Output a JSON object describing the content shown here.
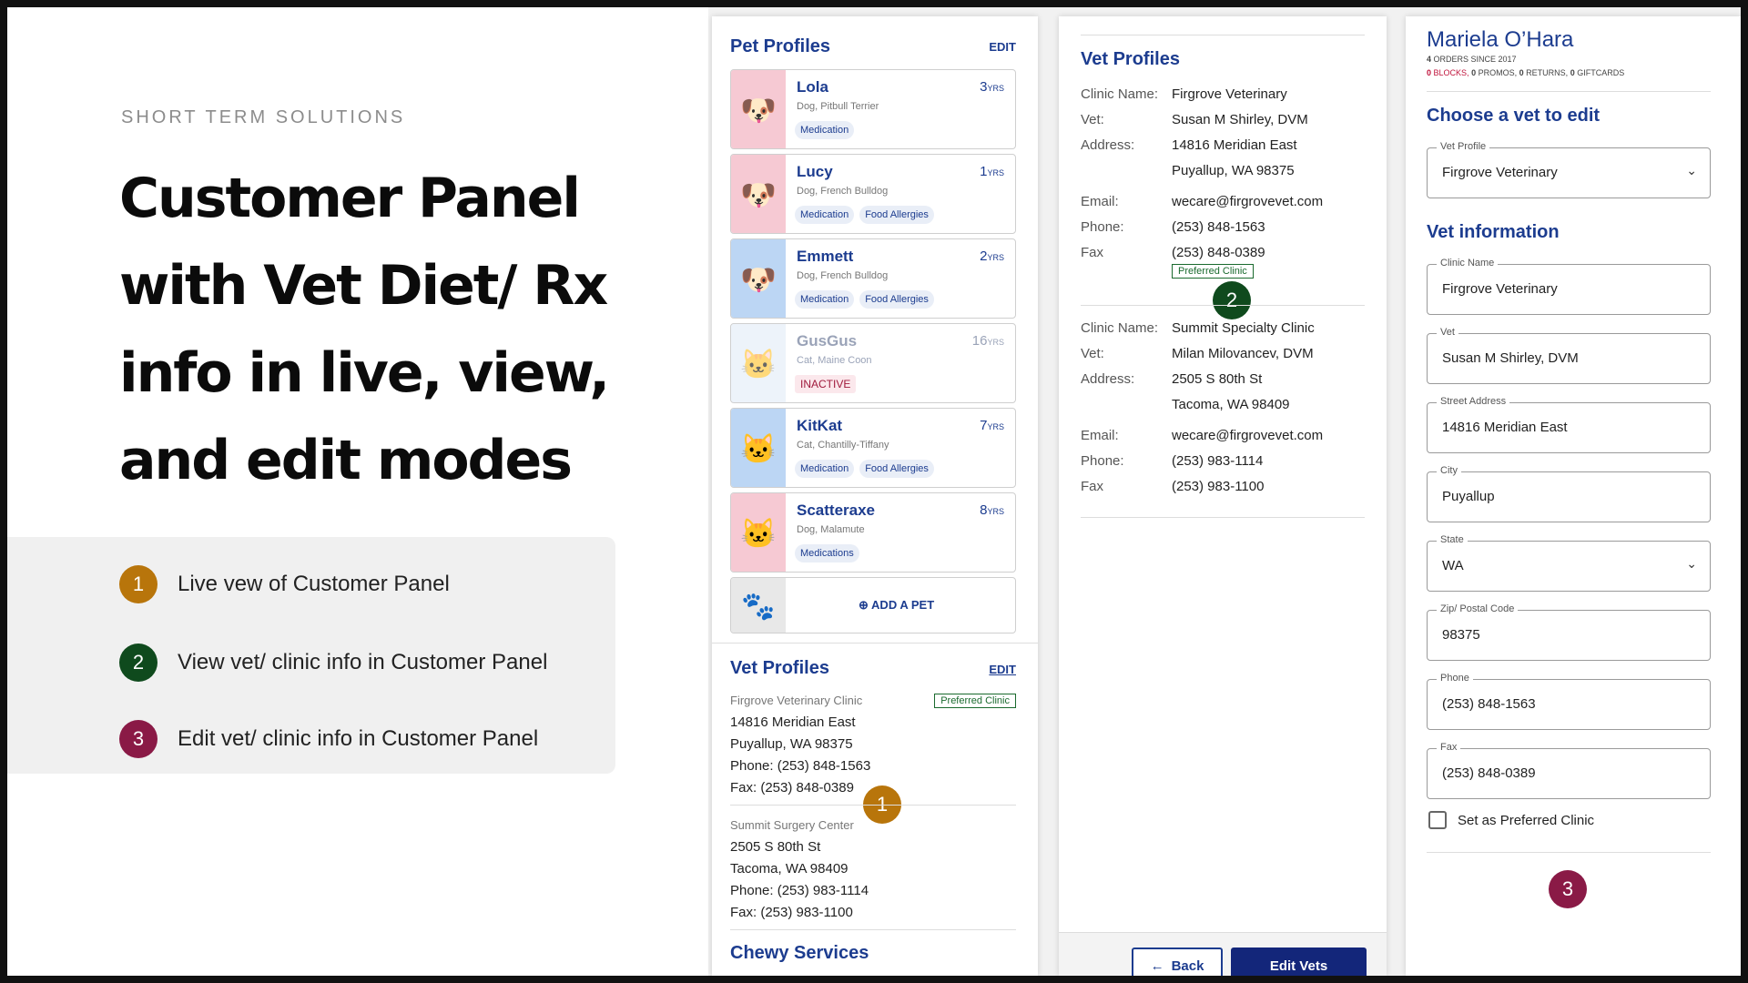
{
  "intro": {
    "eyebrow": "SHORT TERM SOLUTIONS",
    "title_lines": [
      "Customer Panel",
      "with Vet Diet/ Rx",
      "info in live, view,",
      "and edit modes"
    ],
    "legend": [
      {
        "num": "1",
        "text": "Live vew of Customer Panel",
        "color": "#b8750b"
      },
      {
        "num": "2",
        "text": "View vet/ clinic info in Customer Panel",
        "color": "#0f4a1d"
      },
      {
        "num": "3",
        "text": "Edit vet/ clinic info in Customer Panel",
        "color": "#8a1a46"
      }
    ]
  },
  "live": {
    "pet_title": "Pet Profiles",
    "edit_label": "EDIT",
    "pets": [
      {
        "name": "Lola",
        "breed": "Dog, Pitbull Terrier",
        "age": "3",
        "unit": "YRS",
        "tags": [
          "Medication"
        ],
        "icon": "dog-icon",
        "bg": "#f6c9d3"
      },
      {
        "name": "Lucy",
        "breed": "Dog, French Bulldog",
        "age": "1",
        "unit": "YRS",
        "tags": [
          "Medication",
          "Food Allergies"
        ],
        "icon": "dog-icon",
        "bg": "#f6c9d3"
      },
      {
        "name": "Emmett",
        "breed": "Dog, French Bulldog",
        "age": "2",
        "unit": "YRS",
        "tags": [
          "Medication",
          "Food Allergies"
        ],
        "icon": "dog-icon",
        "bg": "#bcd6f4"
      },
      {
        "name": "GusGus",
        "breed": "Cat, Maine Coon",
        "age": "16",
        "unit": "YRS",
        "status": "INACTIVE",
        "icon": "cat-icon",
        "bg": "#e2ecf7"
      },
      {
        "name": "KitKat",
        "breed": "Cat, Chantilly-Tiffany",
        "age": "7",
        "unit": "YRS",
        "tags": [
          "Medication",
          "Food Allergies"
        ],
        "icon": "cat-icon",
        "bg": "#bcd6f4"
      },
      {
        "name": "Scatteraxe",
        "breed": "Dog, Malamute",
        "age": "8",
        "unit": "YRS",
        "tags": [
          "Medications"
        ],
        "icon": "cat-icon",
        "bg": "#f6c9d3"
      }
    ],
    "add_pet": "ADD A PET",
    "vet_title": "Vet Profiles",
    "vets": [
      {
        "clinic": "Firgrove Veterinary Clinic",
        "badge": "Preferred Clinic",
        "address1": "14816 Meridian East",
        "address2": "Puyallup, WA 98375",
        "phone": "Phone: (253) 848-1563",
        "fax": "Fax: (253) 848-0389"
      },
      {
        "clinic": "Summit Surgery Center",
        "address1": "2505 S 80th St",
        "address2": "Tacoma, WA 98409",
        "phone": "Phone: (253) 983-1114",
        "fax": "Fax: (253) 983-1100"
      }
    ],
    "services_title": "Chewy Services"
  },
  "view": {
    "title": "Vet Profiles",
    "labels": {
      "clinic": "Clinic Name:",
      "vet": "Vet:",
      "address": "Address:",
      "email": "Email:",
      "phone": "Phone:",
      "fax": "Fax"
    },
    "vets": [
      {
        "clinic": "Firgrove Veterinary",
        "vet": "Susan M Shirley, DVM",
        "address1": "14816 Meridian East",
        "address2": "Puyallup, WA 98375",
        "email": "wecare@firgrovevet.com",
        "phone": "(253) 848-1563",
        "fax": "(253) 848-0389",
        "badge": "Preferred Clinic"
      },
      {
        "clinic": "Summit Specialty Clinic",
        "vet": "Milan Milovancev, DVM",
        "address1": "2505 S 80th St",
        "address2": "Tacoma, WA 98409",
        "email": "wecare@firgrovevet.com",
        "phone": "(253) 983-1114",
        "fax": "(253) 983-1100"
      }
    ],
    "back": "Back",
    "edit": "Edit Vets"
  },
  "edit": {
    "customer_name": "Mariela O’Hara",
    "orders_count": "4",
    "orders_text": "ORDERS SINCE 2017",
    "blocks_count": "0",
    "blocks_text": "BLOCKS,",
    "promos_count": "0",
    "promos_text": "PROMOS,",
    "returns_count": "0",
    "returns_text": "RETURNS,",
    "giftcards_count": "0",
    "giftcards_text": "GIFTCARDS",
    "choose_title": "Choose a vet to edit",
    "vet_profile_label": "Vet Profile",
    "vet_profile_value": "Firgrove Veterinary",
    "info_title": "Vet information",
    "fields": [
      {
        "label": "Clinic Name",
        "value": "Firgrove Veterinary"
      },
      {
        "label": "Vet",
        "value": "Susan M Shirley, DVM"
      },
      {
        "label": "Street Address",
        "value": "14816 Meridian East"
      },
      {
        "label": "City",
        "value": "Puyallup"
      },
      {
        "label": "State",
        "value": "WA",
        "select": true
      },
      {
        "label": "Zip/ Postal Code",
        "value": "98375"
      },
      {
        "label": "Phone",
        "value": "(253) 848-1563"
      },
      {
        "label": "Fax",
        "value": "(253) 848-0389"
      }
    ],
    "preferred_label": "Set as Preferred Clinic"
  }
}
